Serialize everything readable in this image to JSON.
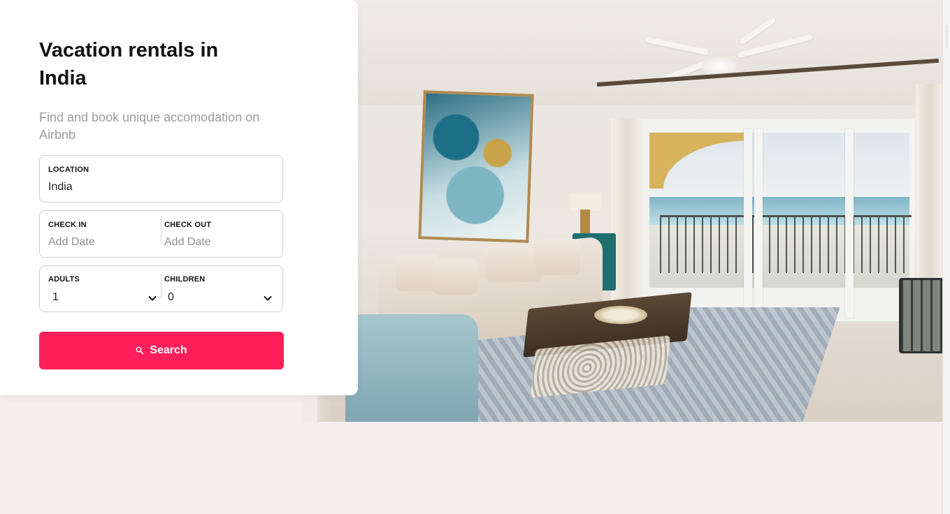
{
  "hero": {
    "title_line1": "Vacation rentals in",
    "title_line2": "India",
    "subtitle": "Find and book unique accomodation on Airbnb"
  },
  "form": {
    "location": {
      "label": "LOCATION",
      "value": "India"
    },
    "check_in": {
      "label": "CHECK IN",
      "placeholder": "Add Date"
    },
    "check_out": {
      "label": "CHECK OUT",
      "placeholder": "Add Date"
    },
    "adults": {
      "label": "ADULTS",
      "value": "1"
    },
    "children": {
      "label": "CHILDREN",
      "value": "0"
    },
    "search_label": "Search"
  },
  "image": {
    "description_icon": "living-room-photo"
  },
  "colors": {
    "accent": "#ff1f5a",
    "page_bg": "#f5eced",
    "card_bg": "#ffffff"
  }
}
